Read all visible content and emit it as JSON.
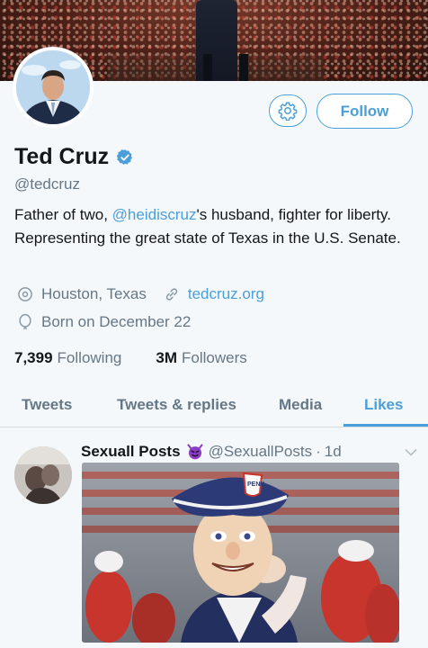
{
  "profile": {
    "name": "Ted Cruz",
    "handle": "@tedcruz",
    "bio_part1": "Father of two, ",
    "bio_mention": "@heidiscruz",
    "bio_part2": "'s husband, fighter for liberty. Representing the great state of Texas in the U.S. Senate.",
    "location": "Houston, Texas",
    "website": "tedcruz.org",
    "birthday": "Born on December 22",
    "following_count": "7,399",
    "following_label": "Following",
    "followers_count": "3M",
    "followers_label": "Followers"
  },
  "actions": {
    "settings_icon": "gear-icon",
    "follow_label": "Follow"
  },
  "tabs": [
    {
      "label": "Tweets"
    },
    {
      "label": "Tweets & replies"
    },
    {
      "label": "Media"
    },
    {
      "label": "Likes",
      "active": true
    }
  ],
  "post": {
    "author": "Sexuall Posts",
    "handle": "@SexuallPosts",
    "separator": "·",
    "time": "1d"
  },
  "colors": {
    "accent": "#4a9fda",
    "text": "#14171a",
    "muted": "#657786",
    "background": "#f5f8fa"
  }
}
